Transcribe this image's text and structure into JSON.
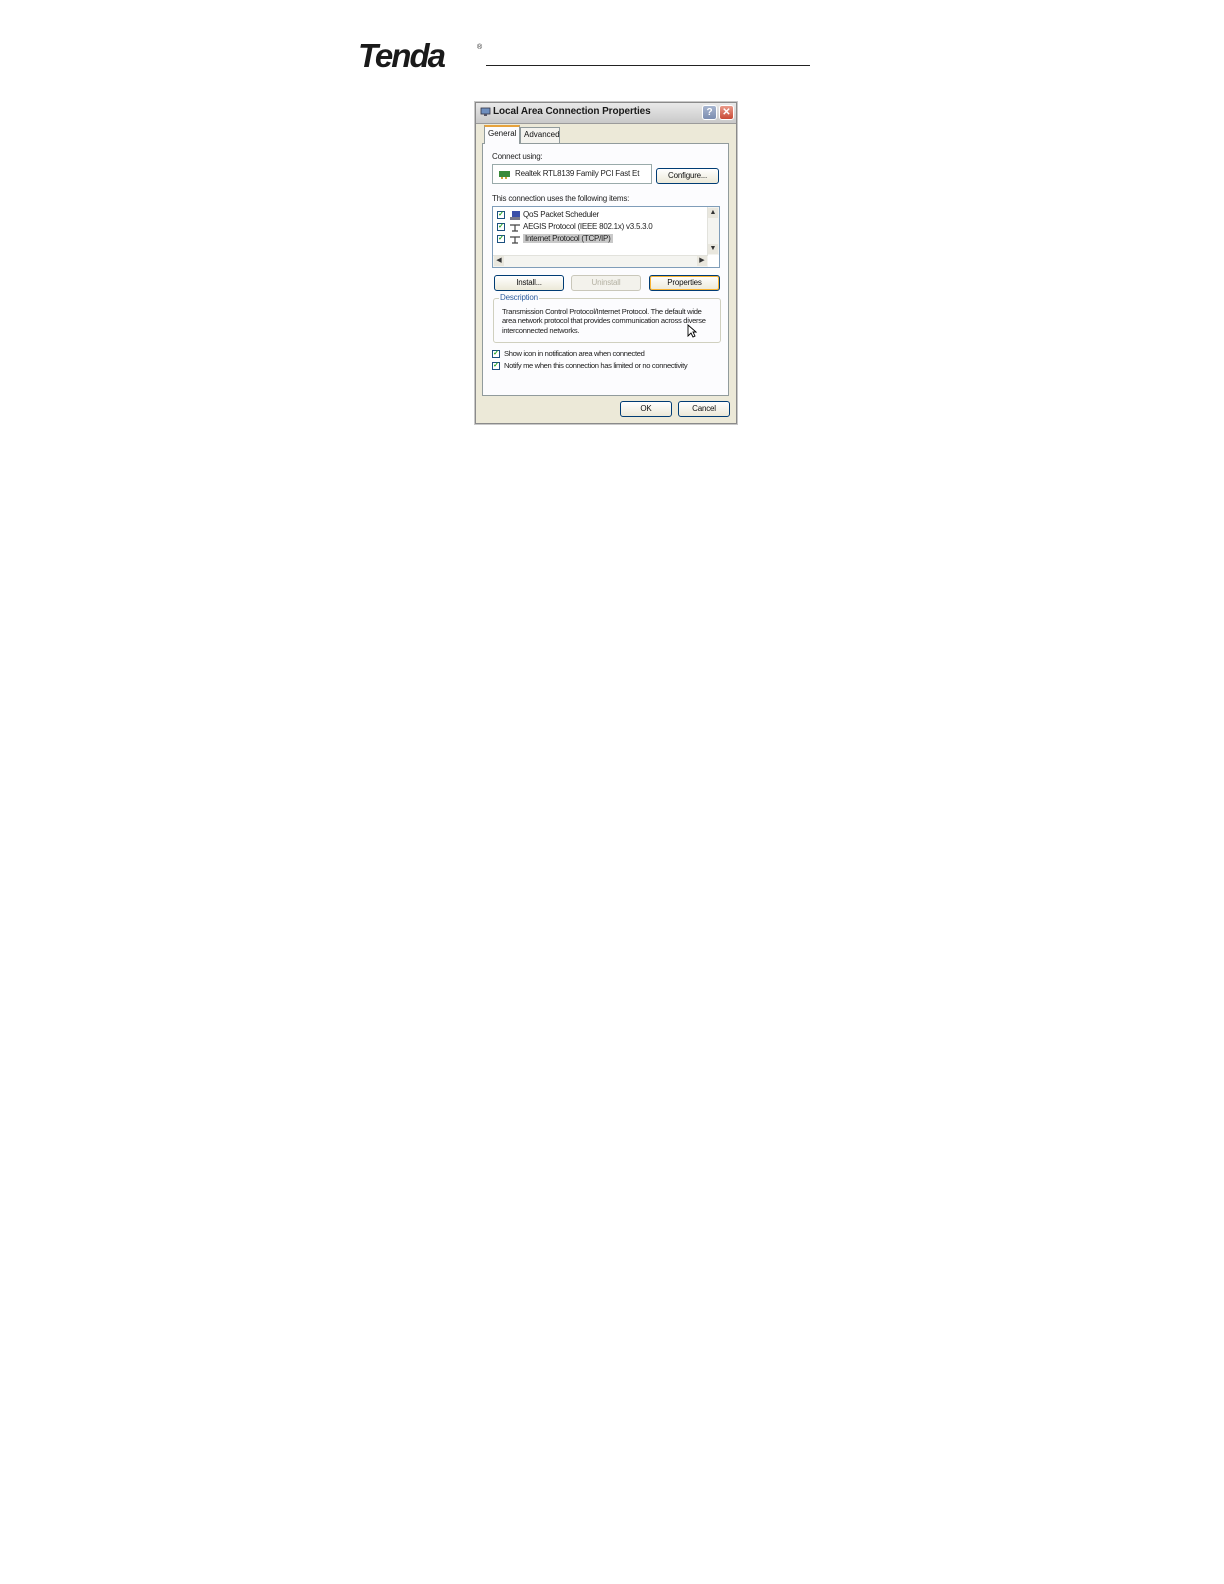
{
  "header": {
    "logo_text": "Tenda"
  },
  "dialog": {
    "title": "Local Area Connection Properties",
    "help_glyph": "?",
    "close_glyph": "✕",
    "tabs": [
      {
        "label": "General"
      },
      {
        "label": "Advanced"
      }
    ],
    "connect_using_label": "Connect using:",
    "adapter_name": "Realtek RTL8139 Family PCI Fast Et",
    "configure_label": "Configure...",
    "items_label": "This connection uses the following items:",
    "items": [
      {
        "label": "QoS Packet Scheduler",
        "checked": true
      },
      {
        "label": "AEGIS Protocol (IEEE 802.1x) v3.5.3.0",
        "checked": true
      },
      {
        "label": "Internet Protocol (TCP/IP)",
        "checked": true,
        "selected": true
      }
    ],
    "install_label": "Install...",
    "uninstall_label": "Uninstall",
    "properties_label": "Properties",
    "description_title": "Description",
    "description_text": "Transmission Control Protocol/Internet Protocol. The default wide area network protocol that provides communication across diverse interconnected networks.",
    "show_icon_label": "Show icon in notification area when connected",
    "notify_label": "Notify me when this connection has limited or no connectivity",
    "ok_label": "OK",
    "cancel_label": "Cancel"
  },
  "colors": {
    "accent": "#e6a23c",
    "check": "#21a121",
    "title_close": "#c94a36"
  }
}
